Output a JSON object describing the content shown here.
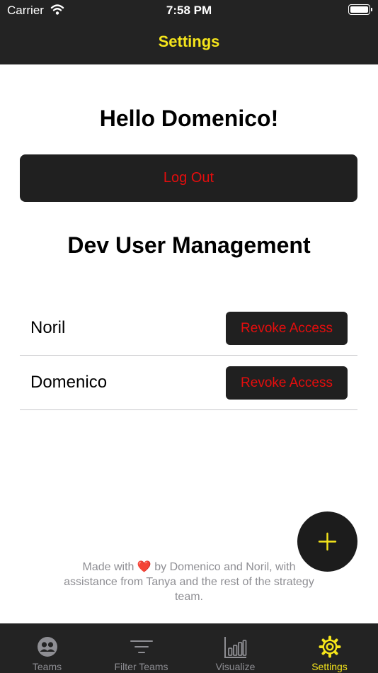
{
  "status_bar": {
    "carrier": "Carrier",
    "time": "7:58 PM",
    "icons": [
      "wifi-icon",
      "battery-icon"
    ]
  },
  "nav": {
    "title": "Settings"
  },
  "greeting": "Hello Domenico!",
  "logout_label": "Log Out",
  "dev_management": {
    "title": "Dev User Management",
    "users": [
      {
        "name": "Noril",
        "action_label": "Revoke Access"
      },
      {
        "name": "Domenico",
        "action_label": "Revoke Access"
      }
    ]
  },
  "fab": {
    "icon": "plus-icon"
  },
  "footer": {
    "before_heart": "Made with ",
    "heart": "❤️",
    "after_heart": " by Domenico and Noril, with assistance from Tanya and the rest of the strategy team."
  },
  "tabbar": {
    "tabs": [
      {
        "label": "Teams",
        "icon": "teams-icon"
      },
      {
        "label": "Filter Teams",
        "icon": "filter-icon"
      },
      {
        "label": "Visualize",
        "icon": "chart-icon"
      },
      {
        "label": "Settings",
        "icon": "gear-icon"
      }
    ],
    "active": "Settings"
  },
  "colors": {
    "bar_background": "#232323",
    "accent_yellow": "#f5e51b",
    "destructive_red": "#e50d0d",
    "button_dark": "#202020",
    "inactive_gray": "#8e8e93"
  }
}
